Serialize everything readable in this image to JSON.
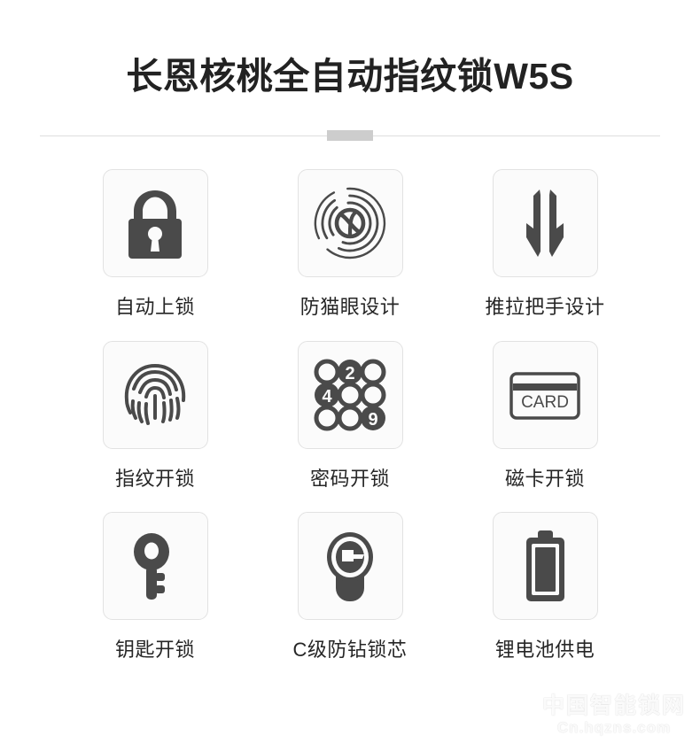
{
  "header": {
    "title": "长恩核桃全自动指纹锁W5S"
  },
  "divider": {
    "line_color": "#dedede",
    "chip_color": "#cdcdcd"
  },
  "theme": {
    "icon_color": "#4a4a4a",
    "tile_background": "#fbfbfb",
    "tile_border": "#e2e2e2",
    "text_color": "#262626",
    "page_background": "#ffffff"
  },
  "features": [
    {
      "icon": "padlock-icon",
      "label": "自动上锁"
    },
    {
      "icon": "anti-peephole-icon",
      "label": "防猫眼设计"
    },
    {
      "icon": "push-pull-handle-icon",
      "label": "推拉把手设计"
    },
    {
      "icon": "fingerprint-icon",
      "label": "指纹开锁"
    },
    {
      "icon": "keypad-icon",
      "label": "密码开锁"
    },
    {
      "icon": "magnetic-card-icon",
      "label": "磁卡开锁"
    },
    {
      "icon": "key-icon",
      "label": "钥匙开锁"
    },
    {
      "icon": "lock-cylinder-icon",
      "label": "C级防钻锁芯"
    },
    {
      "icon": "battery-icon",
      "label": "锂电池供电"
    }
  ],
  "keypad": {
    "digits": [
      "",
      "2",
      "",
      "4",
      "",
      "",
      "",
      "",
      "9"
    ],
    "filled": [
      false,
      true,
      false,
      true,
      false,
      false,
      false,
      false,
      true
    ]
  },
  "card": {
    "label": "CARD"
  },
  "watermark": {
    "line1": "中国智能锁网",
    "line2": "Cn.hqzns.com"
  }
}
